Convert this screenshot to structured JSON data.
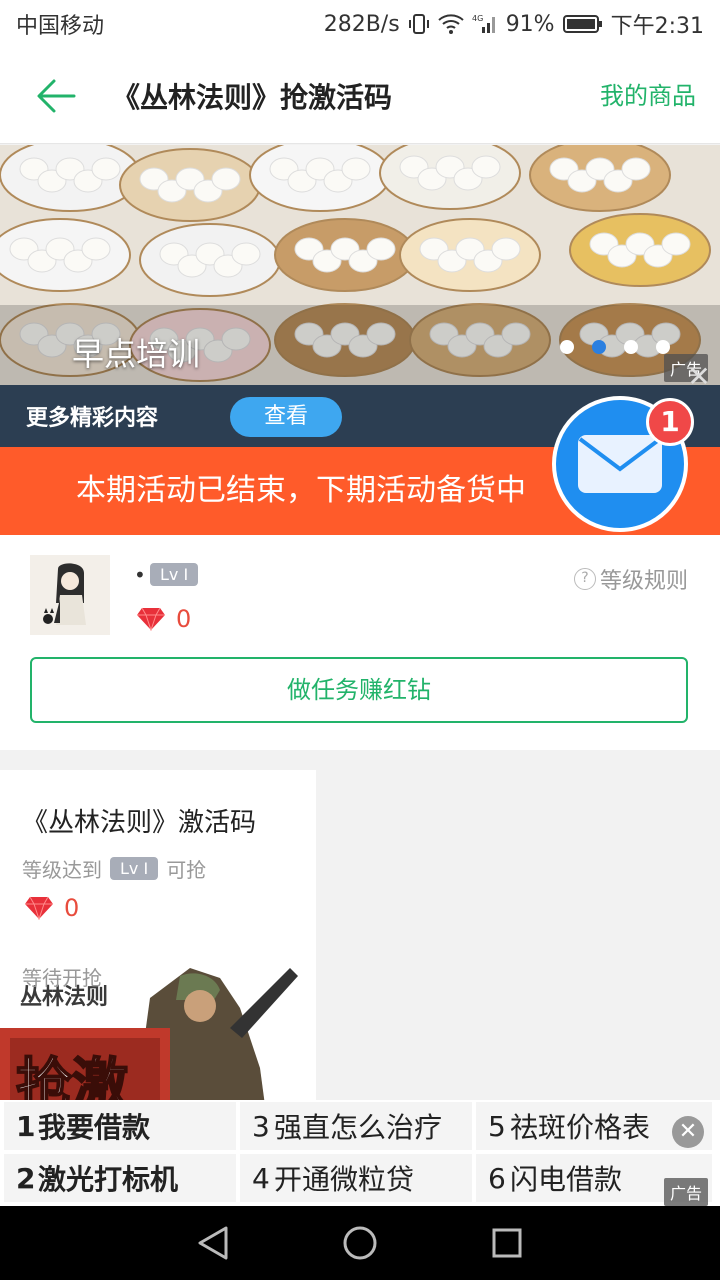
{
  "status_bar": {
    "carrier": "中国移动",
    "speed": "282B/s",
    "battery": "91%",
    "time": "下午2:31"
  },
  "app_bar": {
    "title": "《丛林法则》抢激活码",
    "right_link": "我的商品"
  },
  "banner": {
    "caption": "早点培训",
    "ad_label": "广告",
    "page_count": 4,
    "active_page": 2
  },
  "more_strip": {
    "title": "更多精彩内容",
    "button": "查看"
  },
  "notice": {
    "text": "本期活动已结束，下期活动备货中"
  },
  "message": {
    "badge": "1"
  },
  "user": {
    "bullet": "•",
    "level": "Lv I",
    "diamonds": "0",
    "level_rules": "等级规则",
    "task_button": "做任务赚红钻"
  },
  "product": {
    "title": "《丛林法则》激活码",
    "requirement_prefix": "等级达到",
    "requirement_level": "Lv I",
    "requirement_suffix": "可抢",
    "price": "0",
    "status": "等待开抢",
    "poster_logo": "丛林法则",
    "poster_text": "抢激"
  },
  "bottom_ad": {
    "label": "广告",
    "items": [
      {
        "num": "1",
        "text": "我要借款"
      },
      {
        "num": "2",
        "text": "激光打标机"
      },
      {
        "num": "3",
        "text": "强直怎么治疗"
      },
      {
        "num": "4",
        "text": "开通微粒贷"
      },
      {
        "num": "5",
        "text": "祛斑价格表"
      },
      {
        "num": "6",
        "text": "闪电借款"
      }
    ]
  },
  "colors": {
    "accent_green": "#22b36a",
    "notice_orange": "#ff5b2a",
    "strip_navy": "#2c3e52",
    "diamond_red": "#e84c3d",
    "message_blue": "#1f8ef0"
  }
}
